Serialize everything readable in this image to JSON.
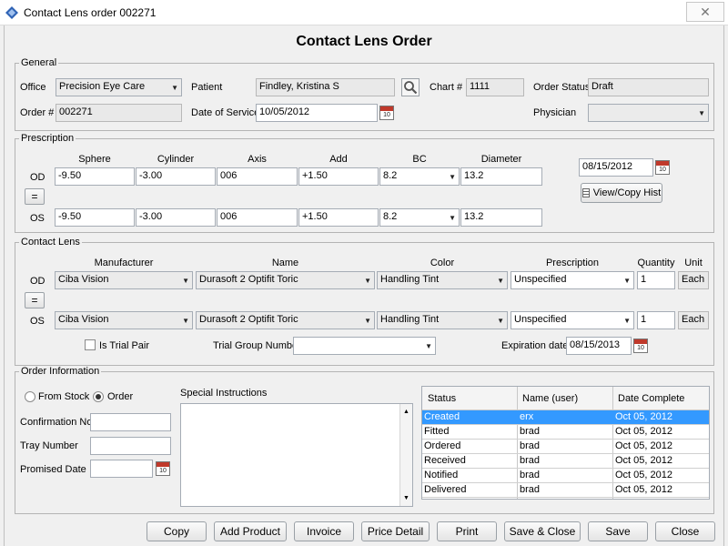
{
  "window": {
    "title": "Contact Lens order 002271",
    "close_label": "✕"
  },
  "heading": "Contact Lens Order",
  "general": {
    "legend": "General",
    "office_label": "Office",
    "office_value": "Precision Eye Care",
    "patient_label": "Patient",
    "patient_value": "Findley, Kristina S",
    "chart_label": "Chart #",
    "chart_value": "1111",
    "order_status_label": "Order Status",
    "order_status_value": "Draft",
    "order_num_label": "Order #",
    "order_num_value": "002271",
    "dos_label": "Date of Service",
    "dos_value": "10/05/2012",
    "physician_label": "Physician",
    "physician_value": ""
  },
  "prescription": {
    "legend": "Prescription",
    "headers": [
      "Sphere",
      "Cylinder",
      "Axis",
      "Add",
      "BC",
      "Diameter"
    ],
    "od_label": "OD",
    "os_label": "OS",
    "copy_label": "=",
    "od": [
      "-9.50",
      "-3.00",
      "006",
      "+1.50",
      "8.2",
      "13.2"
    ],
    "os": [
      "-9.50",
      "-3.00",
      "006",
      "+1.50",
      "8.2",
      "13.2"
    ],
    "date_value": "08/15/2012",
    "view_hist_label": "View/Copy Hist"
  },
  "contact_lens": {
    "legend": "Contact Lens",
    "headers": {
      "manufacturer": "Manufacturer",
      "name": "Name",
      "color": "Color",
      "prescription": "Prescription",
      "quantity": "Quantity",
      "unit": "Unit"
    },
    "od_label": "OD",
    "os_label": "OS",
    "copy_label": "=",
    "od": {
      "manufacturer": "Ciba Vision",
      "name": "Durasoft 2 Optifit Toric",
      "color": "Handling Tint",
      "prescription": "Unspecified",
      "quantity": "1",
      "unit": "Each"
    },
    "os": {
      "manufacturer": "Ciba Vision",
      "name": "Durasoft 2 Optifit Toric",
      "color": "Handling Tint",
      "prescription": "Unspecified",
      "quantity": "1",
      "unit": "Each"
    },
    "trial_pair_label": "Is Trial Pair",
    "trial_group_label": "Trial Group Number",
    "trial_group_value": "",
    "expiration_label": "Expiration date",
    "expiration_value": "08/15/2013"
  },
  "order_info": {
    "legend": "Order Information",
    "from_stock_label": "From Stock",
    "order_label": "Order",
    "confirmation_label": "Confirmation No",
    "confirmation_value": "",
    "tray_label": "Tray Number",
    "tray_value": "",
    "promised_label": "Promised Date",
    "promised_value": "",
    "special_label": "Special Instructions",
    "status_headers": {
      "status": "Status",
      "name": "Name (user)",
      "date": "Date Complete"
    },
    "status_rows": [
      {
        "status": "Created",
        "name": "erx",
        "date": "Oct 05, 2012"
      },
      {
        "status": "Fitted",
        "name": "brad",
        "date": "Oct 05, 2012"
      },
      {
        "status": "Ordered",
        "name": "brad",
        "date": "Oct 05, 2012"
      },
      {
        "status": "Received",
        "name": "brad",
        "date": "Oct 05, 2012"
      },
      {
        "status": "Notified",
        "name": "brad",
        "date": "Oct 05, 2012"
      },
      {
        "status": "Delivered",
        "name": "brad",
        "date": "Oct 05, 2012"
      }
    ]
  },
  "buttons": {
    "copy": "Copy",
    "add_product": "Add Product",
    "invoice": "Invoice",
    "price_detail": "Price Detail",
    "print": "Print",
    "save_close": "Save & Close",
    "save": "Save",
    "close": "Close"
  },
  "calendar_icon_text": "10",
  "colors": {
    "selection": "#3399ff",
    "calendar": "#c0392b"
  }
}
